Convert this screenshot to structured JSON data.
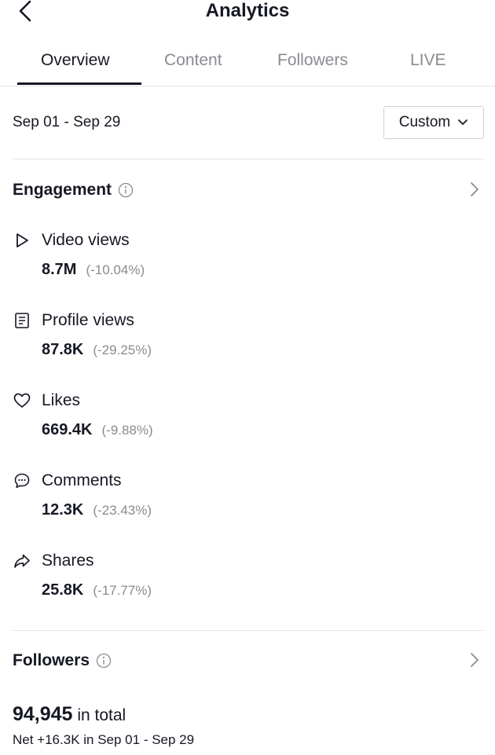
{
  "header": {
    "title": "Analytics"
  },
  "tabs": [
    {
      "label": "Overview",
      "active": true
    },
    {
      "label": "Content",
      "active": false
    },
    {
      "label": "Followers",
      "active": false
    },
    {
      "label": "LIVE",
      "active": false
    }
  ],
  "date_filter": {
    "range": "Sep 01 - Sep 29",
    "selector_label": "Custom"
  },
  "engagement": {
    "title": "Engagement",
    "metrics": [
      {
        "icon": "play-icon",
        "label": "Video views",
        "value": "8.7M",
        "change": "(-10.04%)"
      },
      {
        "icon": "document-icon",
        "label": "Profile views",
        "value": "87.8K",
        "change": "(-29.25%)"
      },
      {
        "icon": "heart-icon",
        "label": "Likes",
        "value": "669.4K",
        "change": "(-9.88%)"
      },
      {
        "icon": "comment-icon",
        "label": "Comments",
        "value": "12.3K",
        "change": "(-23.43%)"
      },
      {
        "icon": "share-icon",
        "label": "Shares",
        "value": "25.8K",
        "change": "(-17.77%)"
      }
    ]
  },
  "followers": {
    "title": "Followers",
    "total": "94,945",
    "total_suffix": "in total",
    "net": "Net +16.3K in Sep 01 - Sep 29"
  },
  "colors": {
    "text": "#161823",
    "muted": "#8a8b91",
    "divider": "#e3e3e4"
  }
}
